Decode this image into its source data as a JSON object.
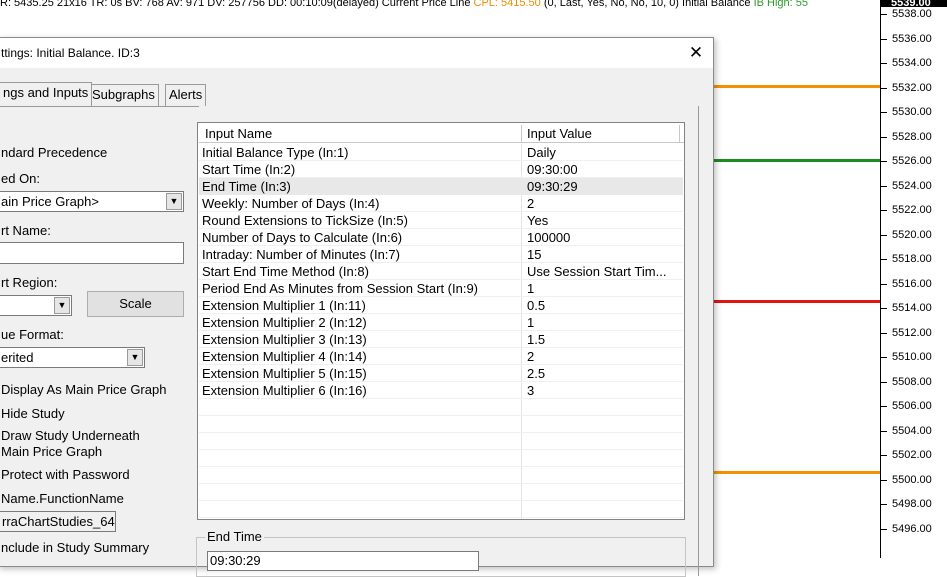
{
  "chart": {
    "status_text": "R: 5435.25 21x16 TR: 0s BV: 768 AV: 971 DV: 257756 DD: 00:10:09(delayed) Current Price Line",
    "cpl_text": "CPL: 5415.50",
    "params_text": "(0, Last, Yes, No, No, 10, 0)  Initial Balance",
    "ib_text": "IB High: 55",
    "current_price": "5539.00",
    "price_labels": [
      "5538.00",
      "5536.00",
      "5534.00",
      "5532.00",
      "5530.00",
      "5528.00",
      "5526.00",
      "5524.00",
      "5522.00",
      "5520.00",
      "5518.00",
      "5516.00",
      "5514.00",
      "5512.00",
      "5510.00",
      "5508.00",
      "5506.00",
      "5504.00",
      "5502.00",
      "5500.00",
      "5498.00",
      "5496.00"
    ],
    "level_lines": [
      {
        "name": "orange-top",
        "color": "#f39200"
      },
      {
        "name": "green",
        "color": "#1e8c1e"
      },
      {
        "name": "red",
        "color": "#e01515"
      },
      {
        "name": "orange-bottom",
        "color": "#f39200"
      }
    ]
  },
  "dialog": {
    "title": "ttings: Initial Balance. ID:3",
    "close_symbol": "✕",
    "tabs": [
      "ngs and Inputs",
      "Subgraphs",
      "Alerts"
    ],
    "left": {
      "standard_precedence": "ndard Precedence",
      "based_on_label": "ed On:",
      "based_on_value": "ain Price Graph>",
      "short_name_label": "rt Name:",
      "short_name_value": "",
      "chart_region_label": "rt Region:",
      "chart_region_value": "",
      "scale_button": "Scale",
      "value_format_label": "ue Format:",
      "value_format_value": "erited",
      "display_as_main": "Display As Main Price Graph",
      "hide_study": "Hide Study",
      "draw_underneath_1": "Draw Study Underneath",
      "draw_underneath_2": "Main Price Graph",
      "protect_password": "Protect with Password",
      "function_name_label": "Name.FunctionName",
      "function_name_value": "rraChartStudies_64",
      "include_summary": "nclude in Study Summary"
    },
    "inputs": {
      "header_name": "Input Name",
      "header_value": "Input Value",
      "rows": [
        {
          "name": "Initial Balance Type  (In:1)",
          "value": "Daily"
        },
        {
          "name": "Start Time  (In:2)",
          "value": "09:30:00"
        },
        {
          "name": "End Time  (In:3)",
          "value": "09:30:29"
        },
        {
          "name": "Weekly: Number of Days  (In:4)",
          "value": "2"
        },
        {
          "name": "Round Extensions to TickSize  (In:5)",
          "value": "Yes"
        },
        {
          "name": "Number of Days to Calculate  (In:6)",
          "value": "100000"
        },
        {
          "name": "Intraday: Number of Minutes  (In:7)",
          "value": "15"
        },
        {
          "name": "Start End Time Method  (In:8)",
          "value": "Use Session Start Tim..."
        },
        {
          "name": "Period End As Minutes from Session Start  (In:9)",
          "value": "1"
        },
        {
          "name": "Extension Multiplier 1  (In:11)",
          "value": "0.5"
        },
        {
          "name": "Extension Multiplier 2  (In:12)",
          "value": "1"
        },
        {
          "name": "Extension Multiplier 3  (In:13)",
          "value": "1.5"
        },
        {
          "name": "Extension Multiplier 4  (In:14)",
          "value": "2"
        },
        {
          "name": "Extension Multiplier 5  (In:15)",
          "value": "2.5"
        },
        {
          "name": "Extension Multiplier 6  (In:16)",
          "value": "3"
        }
      ]
    },
    "end_time_group_label": "End Time",
    "end_time_value": "09:30:29"
  }
}
